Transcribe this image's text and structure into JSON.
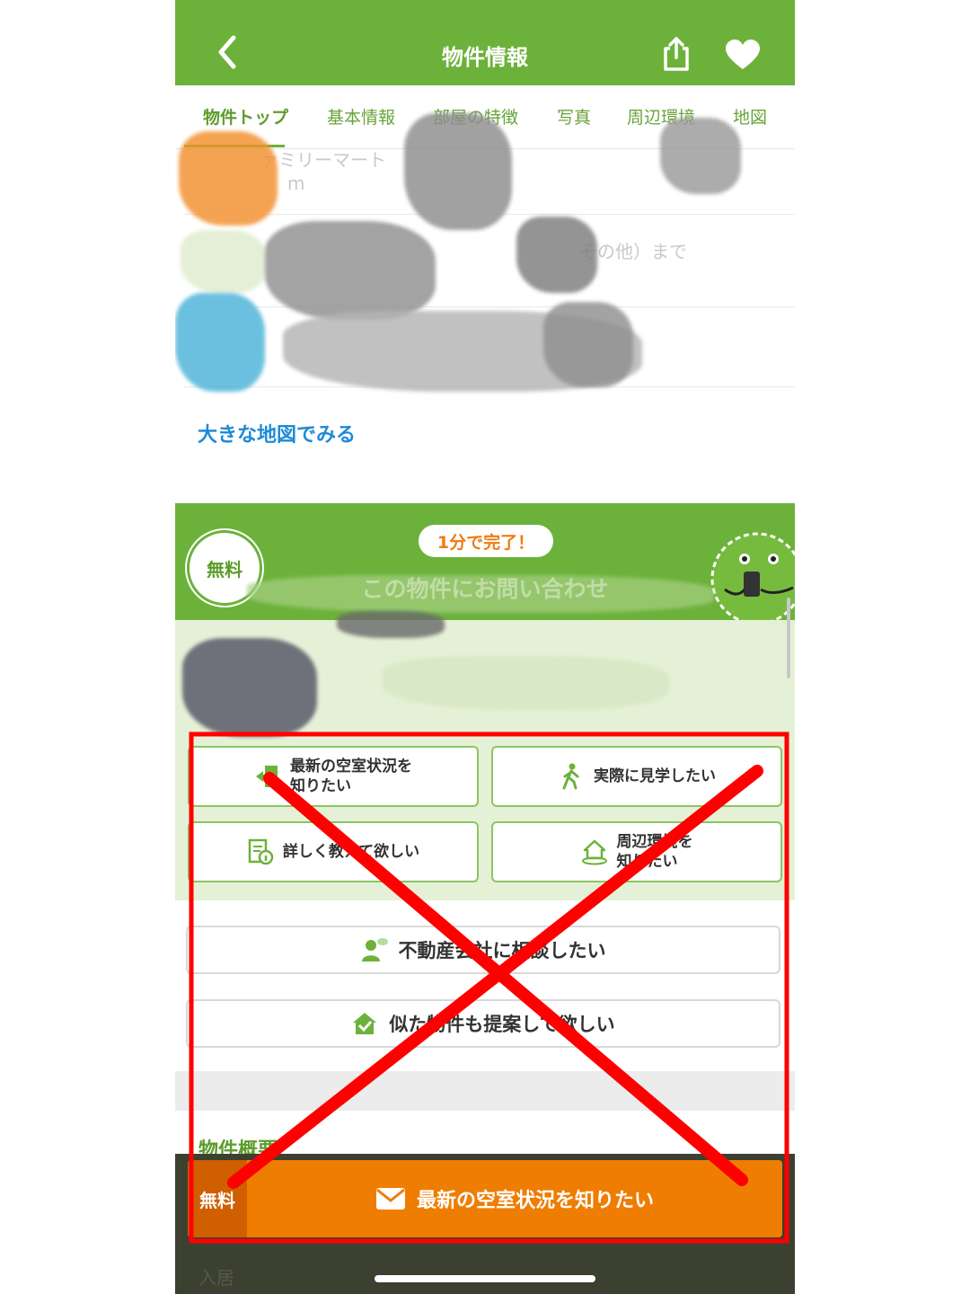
{
  "header": {
    "title": "物件情報",
    "back_icon": "chevron-left-icon",
    "share_icon": "share-icon",
    "favorite_icon": "heart-icon",
    "color": "#6cb23a"
  },
  "tabs": [
    {
      "label": "物件トップ",
      "active": true
    },
    {
      "label": "基本情報",
      "active": false
    },
    {
      "label": "部屋の特徴",
      "active": false
    },
    {
      "label": "写真",
      "active": false
    },
    {
      "label": "周辺環境",
      "active": false
    },
    {
      "label": "地図",
      "active": false
    }
  ],
  "nearby": {
    "row1_text": "ァミリーマート",
    "row1_sub": "m",
    "row2_text": "その他）まで"
  },
  "map_link": "大きな地図でみる",
  "inquiry": {
    "free_badge": "無料",
    "pill": "1分で完了！",
    "title": "この物件にお問い合わせ",
    "options": [
      {
        "label_line1": "最新の空室状況を",
        "label_line2": "知りたい",
        "icon": "door-enter-icon"
      },
      {
        "label_line1": "実際に見学したい",
        "label_line2": "",
        "icon": "walking-person-icon"
      },
      {
        "label_line1": "詳しく教えて欲しい",
        "label_line2": "",
        "icon": "document-info-icon"
      },
      {
        "label_line1": "周辺環境を",
        "label_line2": "知りたい",
        "icon": "house-area-icon"
      }
    ],
    "wide_options": [
      {
        "label": "不動産会社に相談したい",
        "icon": "person-chat-icon"
      },
      {
        "label": "似た物件も提案して欲しい",
        "icon": "house-check-icon"
      }
    ]
  },
  "overview_heading": "物件概要",
  "cta": {
    "free_label": "無料",
    "label": "最新の空室状況を知りたい",
    "icon": "envelope-icon",
    "color": "#ef7d02"
  },
  "bottom_label": "入居",
  "annotation": {
    "color": "#ff0000",
    "shape": "red-x-over-box"
  }
}
